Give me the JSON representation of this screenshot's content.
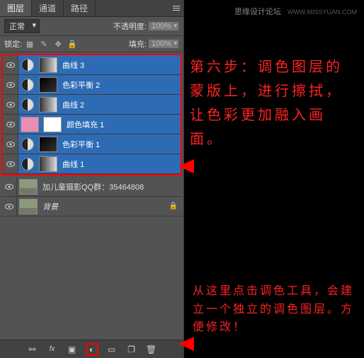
{
  "tabs": {
    "layers": "图层",
    "channels": "通道",
    "paths": "路径"
  },
  "blend_mode": "正常",
  "opacity": {
    "label": "不透明度:",
    "value": "100%"
  },
  "lock": {
    "label": "锁定:",
    "fill_label": "填充:",
    "fill_value": "100%"
  },
  "layers": [
    {
      "name": "曲线 3"
    },
    {
      "name": "色彩平衡 2"
    },
    {
      "name": "曲线 2"
    },
    {
      "name": "颜色填充 1"
    },
    {
      "name": "色彩平衡 1"
    },
    {
      "name": "曲线 1"
    }
  ],
  "group_layer": {
    "name": "加儿童摄影QQ群：",
    "id": "35464808"
  },
  "bg_layer": {
    "name": "背景"
  },
  "watermark": {
    "site": "思缘设计论坛",
    "url": "WWW.MISSYUAN.COM"
  },
  "instruction1": "第六步：调色图层的蒙版上，进行擦拭，让色彩更加融入画面。",
  "instruction2": "从这里点击调色工具，会建立一个独立的调色图层。方便修改！"
}
